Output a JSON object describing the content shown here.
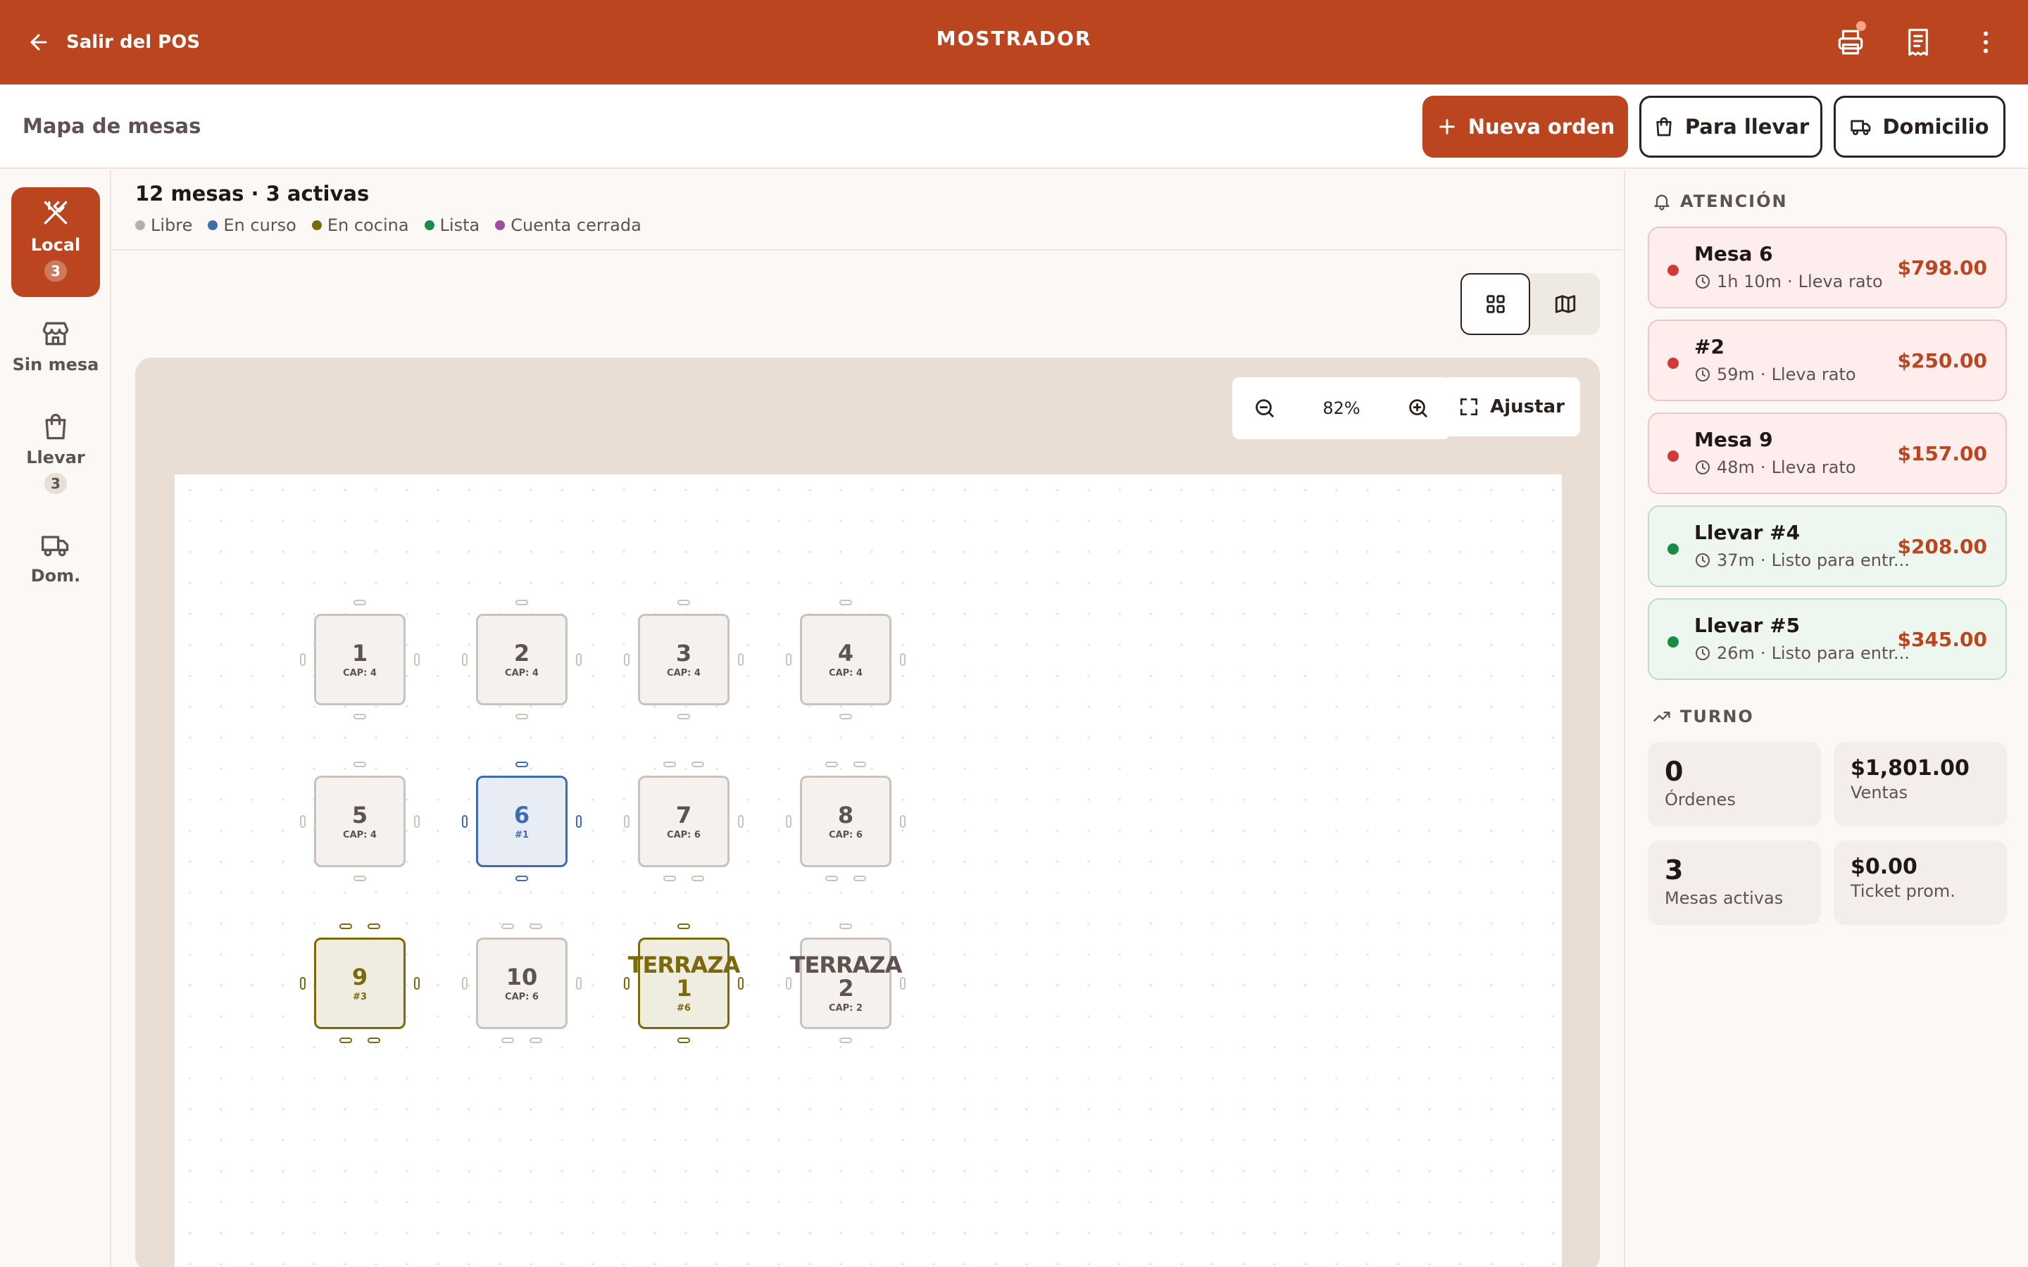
{
  "topbar": {
    "back_label": "Salir del POS",
    "title": "MOSTRADOR",
    "icons": [
      "printer-icon",
      "receipt-icon",
      "more-vertical-icon"
    ]
  },
  "subheader": {
    "title": "Mapa de mesas",
    "new_order_label": "Nueva orden",
    "takeout_label": "Para llevar",
    "delivery_label": "Domicilio"
  },
  "nav": [
    {
      "label": "Local",
      "badge": "3",
      "icon": "utensils-icon"
    },
    {
      "label": "Sin mesa",
      "badge": "",
      "icon": "store-icon"
    },
    {
      "label": "Llevar",
      "badge": "3",
      "icon": "bag-icon"
    },
    {
      "label": "Dom.",
      "badge": "",
      "icon": "truck-icon"
    }
  ],
  "summary": "12 mesas · 3 activas",
  "legend": [
    {
      "label": "Libre",
      "color": "#b5b0ac"
    },
    {
      "label": "En curso",
      "color": "#3f6cb0"
    },
    {
      "label": "En cocina",
      "color": "#7b6a0c"
    },
    {
      "label": "Lista",
      "color": "#1c8a47"
    },
    {
      "label": "Cuenta cerrada",
      "color": "#9b4f9b"
    }
  ],
  "zoom": {
    "value": "82%",
    "fit_label": "Ajustar"
  },
  "tables": [
    {
      "name": "1",
      "sub": "CAP: 4",
      "status": "libre"
    },
    {
      "name": "2",
      "sub": "CAP: 4",
      "status": "libre"
    },
    {
      "name": "3",
      "sub": "CAP: 4",
      "status": "libre"
    },
    {
      "name": "4",
      "sub": "CAP: 4",
      "status": "libre"
    },
    {
      "name": "5",
      "sub": "CAP: 4",
      "status": "libre"
    },
    {
      "name": "6",
      "sub": "#1",
      "status": "en-curso"
    },
    {
      "name": "7",
      "sub": "CAP: 6",
      "status": "libre"
    },
    {
      "name": "8",
      "sub": "CAP: 6",
      "status": "libre"
    },
    {
      "name": "9",
      "sub": "#3",
      "status": "en-cocina"
    },
    {
      "name": "10",
      "sub": "CAP: 6",
      "status": "libre"
    },
    {
      "name": "TERRAZA 1",
      "sub": "#6",
      "status": "en-cocina"
    },
    {
      "name": "TERRAZA 2",
      "sub": "CAP: 2",
      "status": "libre"
    }
  ],
  "attention": {
    "title": "ATENCIÓN",
    "items": [
      {
        "name": "Mesa 6",
        "time": "1h 10m",
        "note": "Lleva rato",
        "amount": "$798.00",
        "status": "late"
      },
      {
        "name": "#2",
        "time": "59m",
        "note": "Lleva rato",
        "amount": "$250.00",
        "status": "late"
      },
      {
        "name": "Mesa 9",
        "time": "48m",
        "note": "Lleva rato",
        "amount": "$157.00",
        "status": "late"
      },
      {
        "name": "Llevar #4",
        "time": "37m",
        "note": "Listo para entr...",
        "amount": "$208.00",
        "status": "ready"
      },
      {
        "name": "Llevar #5",
        "time": "26m",
        "note": "Listo para entr...",
        "amount": "$345.00",
        "status": "ready"
      }
    ]
  },
  "shift": {
    "title": "TURNO",
    "stats": [
      {
        "value": "0",
        "label": "Órdenes"
      },
      {
        "value": "$1,801.00",
        "label": "Ventas"
      },
      {
        "value": "3",
        "label": "Mesas activas"
      },
      {
        "value": "$0.00",
        "label": "Ticket prom."
      }
    ]
  }
}
